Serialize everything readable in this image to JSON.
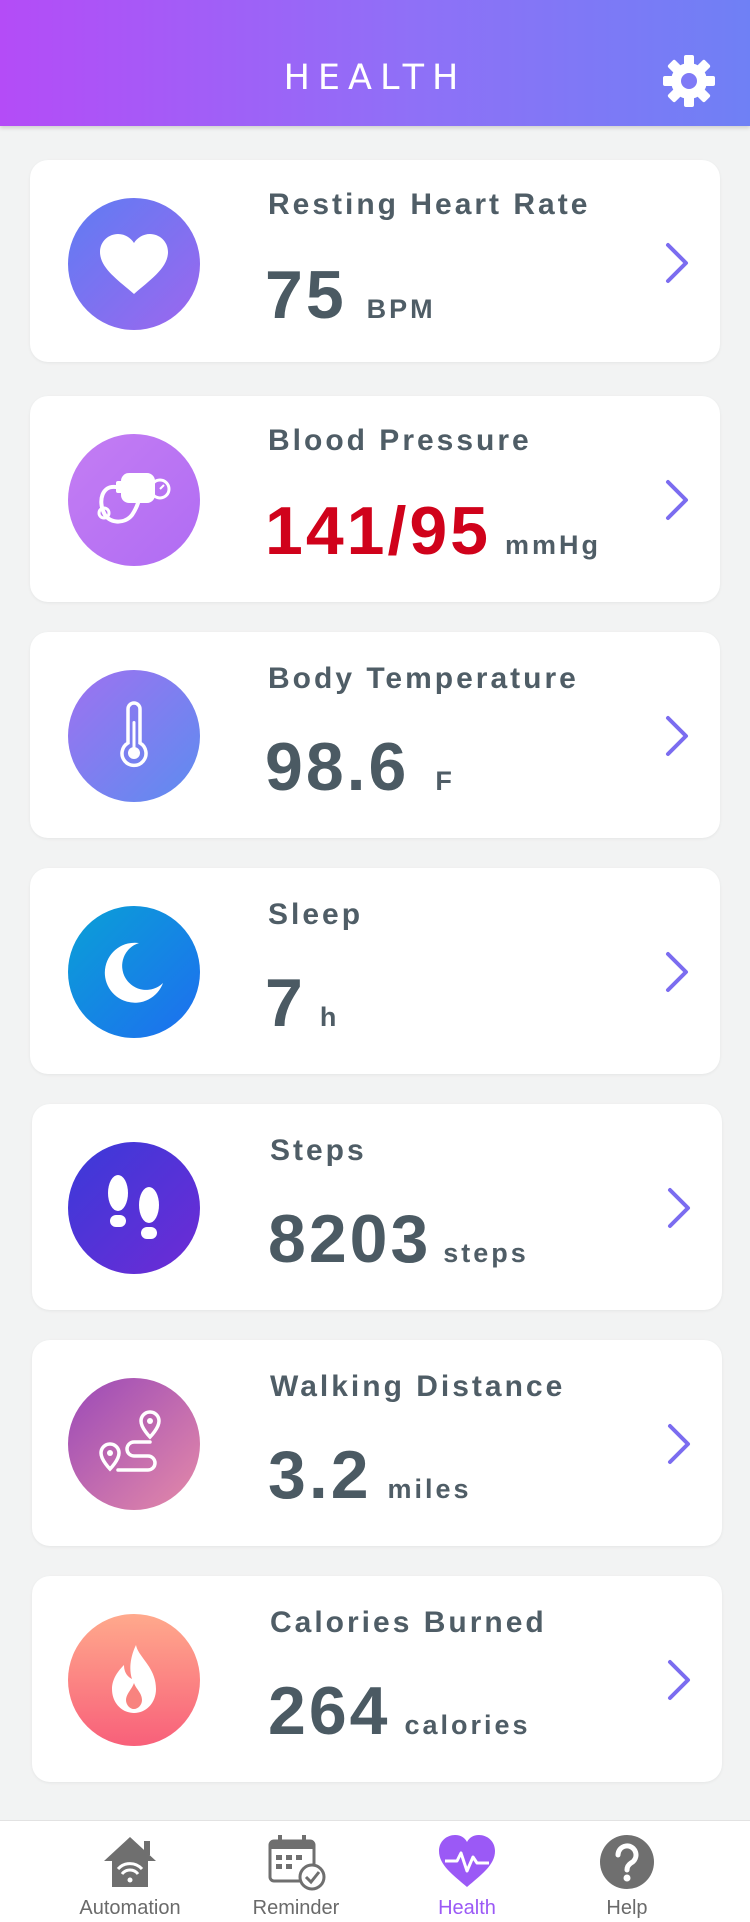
{
  "header": {
    "title": "HEALTH"
  },
  "cards": [
    {
      "label": "Resting Heart Rate",
      "value": "75",
      "unit": "BPM"
    },
    {
      "label": "Blood Pressure",
      "value": "141/95",
      "unit": "mmHg",
      "value_color": "#d0021b"
    },
    {
      "label": "Body Temperature",
      "value": "98.6",
      "unit": "F"
    },
    {
      "label": "Sleep",
      "value": "7",
      "unit": "h"
    },
    {
      "label": "Steps",
      "value": "8203",
      "unit": "steps"
    },
    {
      "label": "Walking Distance",
      "value": "3.2",
      "unit": "miles"
    },
    {
      "label": "Calories Burned",
      "value": "264",
      "unit": "calories"
    }
  ],
  "icons": [
    "heart-icon",
    "blood-pressure-cuff-icon",
    "thermometer-icon",
    "moon-icon",
    "footprints-icon",
    "route-icon",
    "flame-icon"
  ],
  "tabs": [
    {
      "label": "Automation",
      "icon": "home-wifi-icon"
    },
    {
      "label": "Reminder",
      "icon": "calendar-check-icon"
    },
    {
      "label": "Health",
      "icon": "heart-pulse-icon",
      "active": true
    },
    {
      "label": "Help",
      "icon": "question-icon"
    }
  ],
  "colors": {
    "accent": "#9b59f6",
    "alert": "#d0021b",
    "text": "#4b5a63",
    "chevron": "#7b6cf0"
  }
}
